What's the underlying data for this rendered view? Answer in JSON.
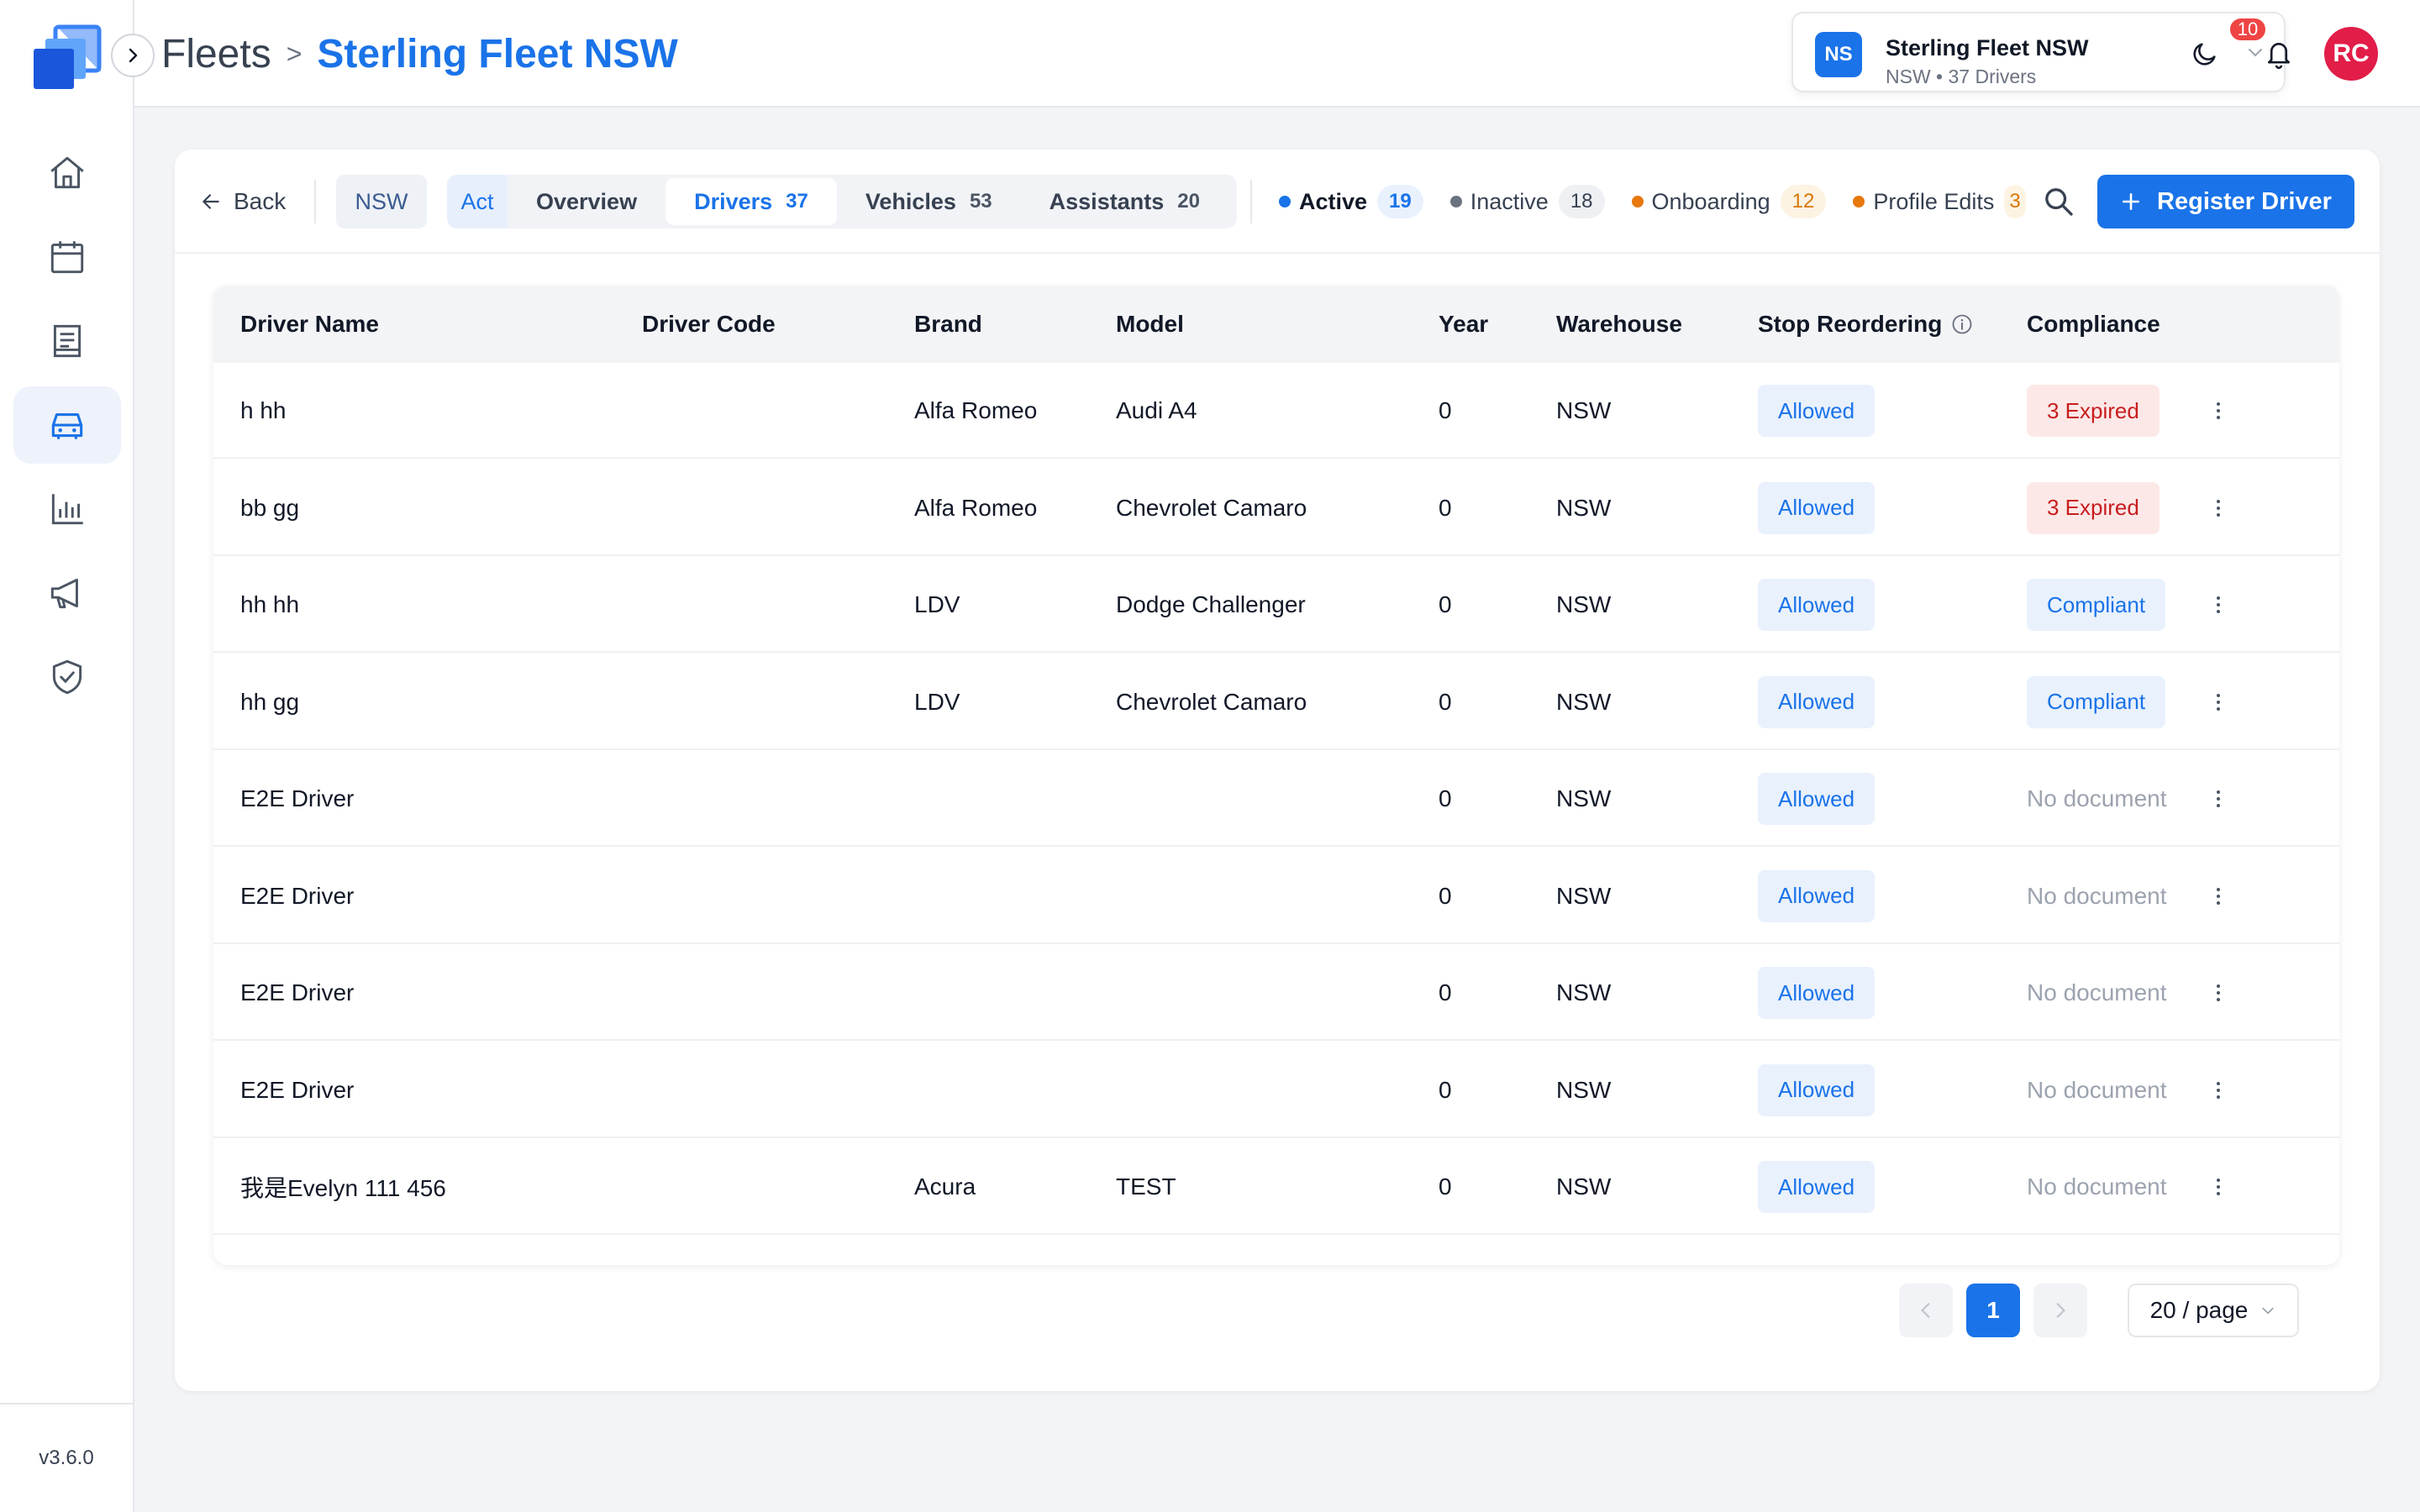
{
  "app": {
    "version": "v3.6.0",
    "colors": {
      "accent": "#1a73e8",
      "danger": "#c81e1e",
      "avatar": "#e11d48"
    }
  },
  "sidebar": {
    "items": [
      {
        "icon": "home-icon",
        "active": false
      },
      {
        "icon": "calendar-icon",
        "active": false
      },
      {
        "icon": "receipt-icon",
        "active": false
      },
      {
        "icon": "car-icon",
        "active": true
      },
      {
        "icon": "chart-icon",
        "active": false
      },
      {
        "icon": "megaphone-icon",
        "active": false
      },
      {
        "icon": "shield-check-icon",
        "active": false
      }
    ]
  },
  "header": {
    "breadcrumb_parent": "Fleets",
    "breadcrumb_sep": ">",
    "breadcrumb_current": "Sterling Fleet NSW",
    "fleet": {
      "initials": "NS",
      "name": "Sterling Fleet NSW",
      "subtitle": "NSW • 37 Drivers"
    },
    "notifications_count": "10",
    "user_initials": "RC"
  },
  "toolbar": {
    "back_label": "Back",
    "region_chip": "NSW",
    "act_label": "Act",
    "tabs": [
      {
        "label": "Overview",
        "count": ""
      },
      {
        "label": "Drivers",
        "count": "37"
      },
      {
        "label": "Vehicles",
        "count": "53"
      },
      {
        "label": "Assistants",
        "count": "20"
      }
    ],
    "status_filters": [
      {
        "label": "Active",
        "count": "19",
        "dot": "#1a73e8",
        "badge_bg": "#e9f1fd",
        "badge_fg": "#1a73e8"
      },
      {
        "label": "Inactive",
        "count": "18",
        "dot": "#6b7280",
        "badge_bg": "#eef0f3",
        "badge_fg": "#374151"
      },
      {
        "label": "Onboarding",
        "count": "12",
        "dot": "#e8770e",
        "badge_bg": "#fdf3e3",
        "badge_fg": "#d97706"
      },
      {
        "label": "Profile Edits",
        "count": "3",
        "dot": "#e8770e",
        "badge_bg": "#fdf3e3",
        "badge_fg": "#d97706"
      }
    ],
    "register_label": "Register Driver"
  },
  "table": {
    "columns": [
      "Driver Name",
      "Driver Code",
      "Brand",
      "Model",
      "Year",
      "Warehouse",
      "Stop Reordering",
      "Compliance"
    ],
    "rows": [
      {
        "name": "h hh",
        "code": "",
        "brand": "Alfa Romeo",
        "model": "Audi A4",
        "year": "0",
        "warehouse": "NSW",
        "stop": "Allowed",
        "compliance": "3 Expired",
        "compliance_type": "expired"
      },
      {
        "name": "bb gg",
        "code": "",
        "brand": "Alfa Romeo",
        "model": "Chevrolet Camaro",
        "year": "0",
        "warehouse": "NSW",
        "stop": "Allowed",
        "compliance": "3 Expired",
        "compliance_type": "expired"
      },
      {
        "name": "hh hh",
        "code": "",
        "brand": "LDV",
        "model": "Dodge Challenger",
        "year": "0",
        "warehouse": "NSW",
        "stop": "Allowed",
        "compliance": "Compliant",
        "compliance_type": "compliant"
      },
      {
        "name": "hh gg",
        "code": "",
        "brand": "LDV",
        "model": "Chevrolet Camaro",
        "year": "0",
        "warehouse": "NSW",
        "stop": "Allowed",
        "compliance": "Compliant",
        "compliance_type": "compliant"
      },
      {
        "name": "E2E Driver",
        "code": "",
        "brand": "",
        "model": "",
        "year": "0",
        "warehouse": "NSW",
        "stop": "Allowed",
        "compliance": "No document",
        "compliance_type": "none"
      },
      {
        "name": "E2E Driver",
        "code": "",
        "brand": "",
        "model": "",
        "year": "0",
        "warehouse": "NSW",
        "stop": "Allowed",
        "compliance": "No document",
        "compliance_type": "none"
      },
      {
        "name": "E2E Driver",
        "code": "",
        "brand": "",
        "model": "",
        "year": "0",
        "warehouse": "NSW",
        "stop": "Allowed",
        "compliance": "No document",
        "compliance_type": "none"
      },
      {
        "name": "E2E Driver",
        "code": "",
        "brand": "",
        "model": "",
        "year": "0",
        "warehouse": "NSW",
        "stop": "Allowed",
        "compliance": "No document",
        "compliance_type": "none"
      },
      {
        "name": "我是Evelyn 111 456",
        "code": "",
        "brand": "Acura",
        "model": "TEST",
        "year": "0",
        "warehouse": "NSW",
        "stop": "Allowed",
        "compliance": "No document",
        "compliance_type": "none"
      }
    ]
  },
  "pagination": {
    "current_page": "1",
    "page_size_label": "20 / page"
  }
}
